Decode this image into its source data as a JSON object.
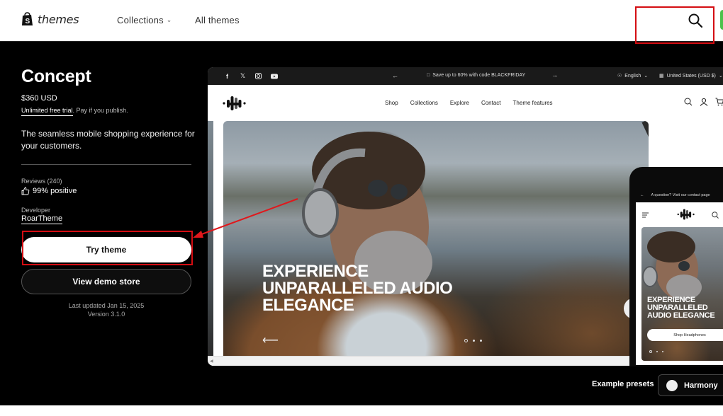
{
  "header": {
    "logo_text": "themes",
    "nav": [
      {
        "label": "Collections",
        "has_dropdown": true
      },
      {
        "label": "All themes",
        "has_dropdown": false
      }
    ],
    "search_icon": "search-icon"
  },
  "theme": {
    "name": "Concept",
    "price": "$360 USD",
    "trial_link": "Unlimited free trial",
    "trial_suffix": ". Pay if you publish.",
    "description": "The seamless mobile shopping experience for your customers.",
    "reviews_label": "Reviews (240)",
    "reviews_value": "99% positive",
    "developer_label": "Developer",
    "developer_name": "RoarTheme",
    "try_button": "Try theme",
    "demo_button": "View demo store",
    "last_updated": "Last updated Jan 15, 2025",
    "version": "Version 3.1.0"
  },
  "preview": {
    "social_icons": [
      "facebook-icon",
      "x-icon",
      "instagram-icon",
      "youtube-icon"
    ],
    "announcement": "Save up to 60% with code BLACKFRIDAY",
    "language": "English",
    "currency": "United States (USD $)",
    "store_nav": [
      "Shop",
      "Collections",
      "Explore",
      "Contact",
      "Theme features"
    ],
    "hero_heading": [
      "EXPERIENCE",
      "UNPARALLELED AUDIO",
      "ELEGANCE"
    ],
    "hero_slides": 3,
    "hero_active_slide": 1
  },
  "mobile_preview": {
    "announcement": "A question? Visit our contact page",
    "hero_heading": [
      "EXPERIENCE",
      "UNPARALLELED",
      "AUDIO ELEGANCE"
    ],
    "cta": "Shop Headphones"
  },
  "presets": {
    "label": "Example presets",
    "selected": "Harmony",
    "swatch_color": "#eeeeee"
  },
  "annotation": {
    "highlight_color": "#d40d12"
  }
}
